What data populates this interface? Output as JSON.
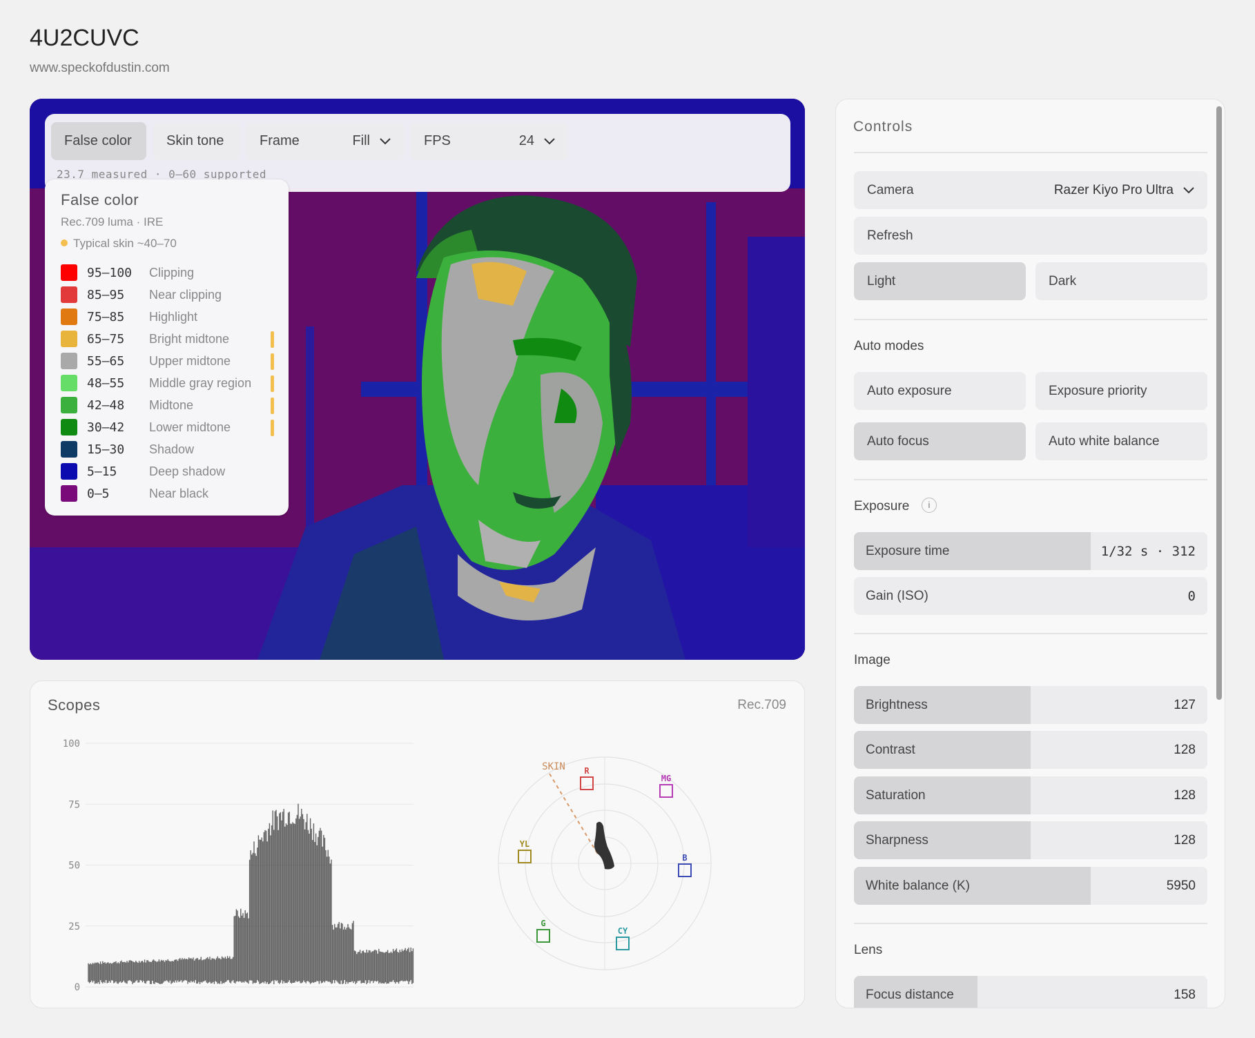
{
  "app": {
    "title": "4U2CUVC",
    "url": "www.speckofdustin.com"
  },
  "toolbar": {
    "false_color": "False color",
    "skin_tone": "Skin tone",
    "frame_label": "Frame",
    "frame_value": "Fill",
    "fps_label": "FPS",
    "fps_value": "24",
    "status": "23.7 measured · 0–60 supported"
  },
  "legend": {
    "title": "False color",
    "subtitle": "Rec.709 luma · IRE",
    "skin_note": "Typical skin ~40–70",
    "rows": [
      {
        "range": "95–100",
        "label": "Clipping",
        "color": "#ff0000",
        "skin": false
      },
      {
        "range": "85–95",
        "label": "Near clipping",
        "color": "#e23a3a",
        "skin": false
      },
      {
        "range": "75–85",
        "label": "Highlight",
        "color": "#e07a10",
        "skin": false
      },
      {
        "range": "65–75",
        "label": "Bright midtone",
        "color": "#e8b43c",
        "skin": true
      },
      {
        "range": "55–65",
        "label": "Upper midtone",
        "color": "#a9a9a9",
        "skin": true
      },
      {
        "range": "48–55",
        "label": "Middle gray region",
        "color": "#66dd66",
        "skin": true
      },
      {
        "range": "42–48",
        "label": "Midtone",
        "color": "#3cb03c",
        "skin": true
      },
      {
        "range": "30–42",
        "label": "Lower midtone",
        "color": "#118a11",
        "skin": true
      },
      {
        "range": "15–30",
        "label": "Shadow",
        "color": "#0e3a66",
        "skin": false
      },
      {
        "range": "5–15",
        "label": "Deep shadow",
        "color": "#0b0bb0",
        "skin": false
      },
      {
        "range": "0–5",
        "label": "Near black",
        "color": "#7a0a7a",
        "skin": false
      }
    ]
  },
  "scopes": {
    "title": "Scopes",
    "standard": "Rec.709",
    "waveform_ticks": [
      "100",
      "75",
      "50",
      "25",
      "0"
    ],
    "vectorscope_targets": [
      {
        "name": "R",
        "color": "#d24646"
      },
      {
        "name": "MG",
        "color": "#b63cb6"
      },
      {
        "name": "B",
        "color": "#3c4cb4"
      },
      {
        "name": "CY",
        "color": "#2a9aa0"
      },
      {
        "name": "G",
        "color": "#3c963c"
      },
      {
        "name": "YL",
        "color": "#a08a20"
      }
    ],
    "skin_line_label": "SKIN"
  },
  "controls": {
    "title": "Controls",
    "camera_label": "Camera",
    "camera_value": "Razer Kiyo Pro Ultra",
    "refresh": "Refresh",
    "light": "Light",
    "dark": "Dark",
    "auto_modes_label": "Auto modes",
    "auto_exposure": "Auto exposure",
    "exposure_priority": "Exposure priority",
    "auto_focus": "Auto focus",
    "auto_white_balance": "Auto white balance",
    "exposure_label": "Exposure",
    "info_glyph": "i",
    "exposure_time": {
      "label": "Exposure time",
      "value": "1/32 s · 312",
      "fraction": 0.67
    },
    "gain": {
      "label": "Gain (ISO)",
      "value": "0",
      "fraction": 0
    },
    "image_label": "Image",
    "brightness": {
      "label": "Brightness",
      "value": "127",
      "fraction": 0.5
    },
    "contrast": {
      "label": "Contrast",
      "value": "128",
      "fraction": 0.5
    },
    "saturation": {
      "label": "Saturation",
      "value": "128",
      "fraction": 0.5
    },
    "sharpness": {
      "label": "Sharpness",
      "value": "128",
      "fraction": 0.5
    },
    "white_balance": {
      "label": "White balance (K)",
      "value": "5950",
      "fraction": 0.67
    },
    "lens_label": "Lens",
    "focus_distance": {
      "label": "Focus distance",
      "value": "158",
      "fraction": 0.35
    }
  }
}
